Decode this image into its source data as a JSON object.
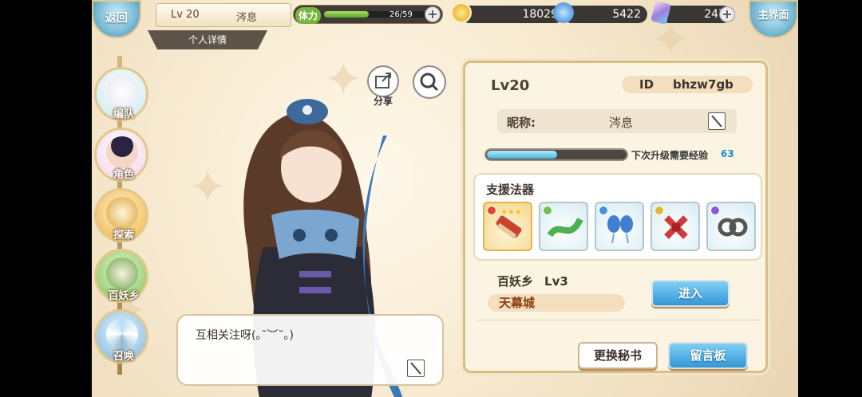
{
  "topbar": {
    "back_label": "返回",
    "home_label": "主界面",
    "player_level": "Lv 20",
    "player_name": "涔息",
    "sub_tab": "个人详情",
    "stamina_label": "体力",
    "stamina_value": "26/59",
    "stamina_fraction": 0.44,
    "gold": "18029",
    "blue_gem": "5422",
    "crystal": "247"
  },
  "sidenav": {
    "items": [
      {
        "label": "编队"
      },
      {
        "label": "角色"
      },
      {
        "label": "探索"
      },
      {
        "label": "百妖乡"
      },
      {
        "label": "召唤"
      }
    ]
  },
  "character": {
    "share_label": "分享",
    "speech_text": "互相关注呀(｡˘︶˘｡)"
  },
  "profile": {
    "level": "Lv20",
    "id_label": "ID",
    "id_value": "bhzw7gb",
    "nickname_label": "昵称:",
    "nickname_value": "涔息",
    "exp_label": "下次升级需要经验",
    "exp_value": "63",
    "exp_fraction": 0.5,
    "support_title": "支援法器",
    "realm_name": "百妖乡",
    "realm_level": "Lv3",
    "city_name": "天幕城",
    "enter_label": "进入",
    "change_secretary_label": "更换秘书",
    "message_board_label": "留言板"
  },
  "colors": {
    "accent_blue": "#3597d6",
    "panel_bg": "#fbf4e3",
    "border_gold": "#d9bd86"
  }
}
